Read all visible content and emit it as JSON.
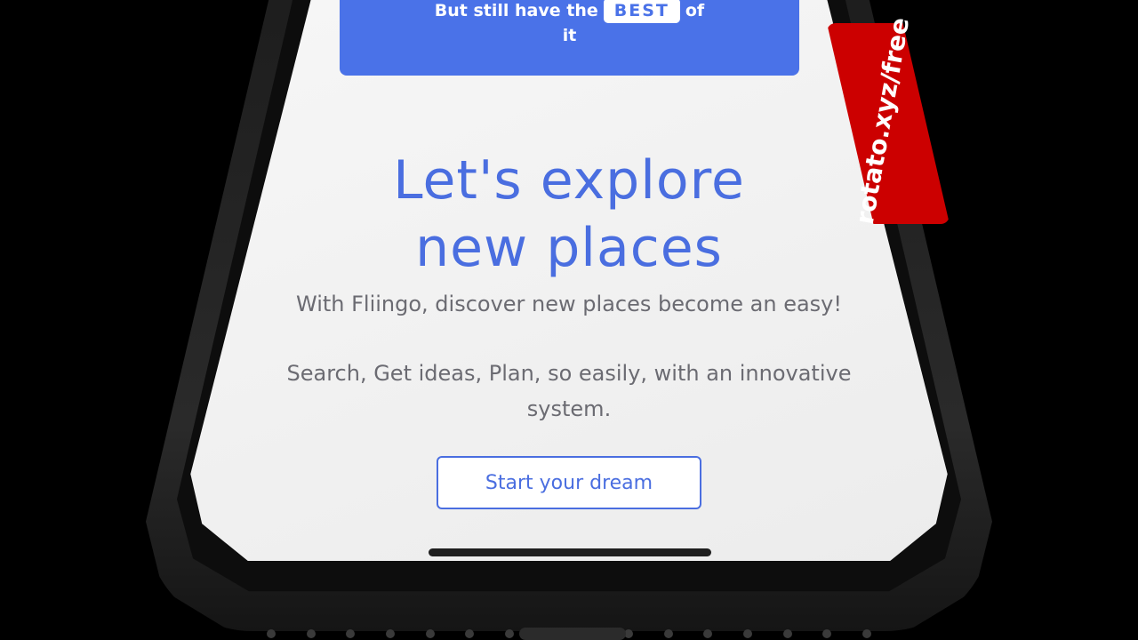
{
  "banner": {
    "text_before": "But still have the",
    "badge": "BEST",
    "text_after": "of",
    "text_line2": "it"
  },
  "hero": {
    "headline_line1": "Let's explore",
    "headline_line2": "new places",
    "description_line1": "With Fliingo, discover new places become an easy!",
    "description_line2": "Search, Get ideas, Plan, so easily, with an innovative system.",
    "cta_label": "Start your dream"
  },
  "watermark": {
    "text": "rotato.xyz/free"
  },
  "colors": {
    "accent": "#4a6ee0",
    "banner": "#4a72e8",
    "tag": "#cc0000",
    "body_text": "#6b6b72"
  }
}
